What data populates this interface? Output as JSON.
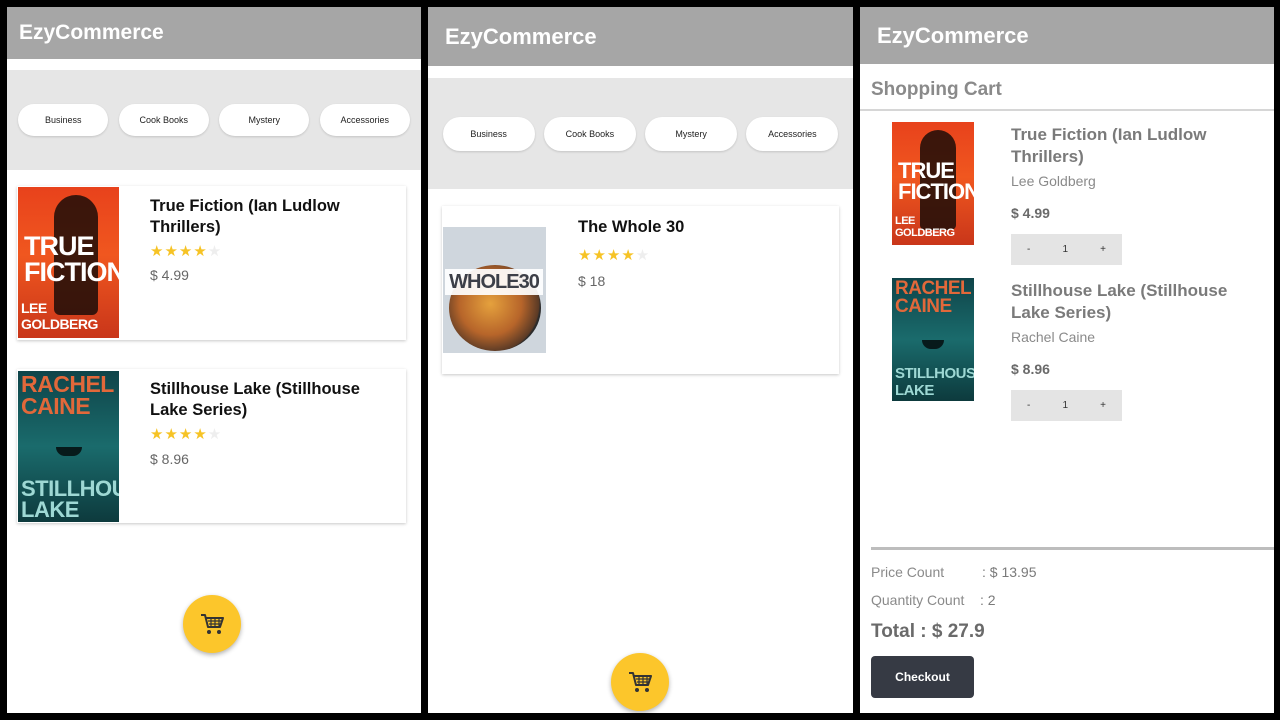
{
  "app": {
    "title": "EzyCommerce"
  },
  "categories": [
    "Business",
    "Cook Books",
    "Mystery",
    "Accessories"
  ],
  "colors": {
    "appbar": "#a6a6a6",
    "star": "#f6c325",
    "fab": "#fcc62b",
    "checkout_button": "#363a44"
  },
  "screen1": {
    "products": [
      {
        "title": "True Fiction (Ian Ludlow Thrillers)",
        "rating": 4,
        "max_rating": 5,
        "price": "$ 4.99",
        "cover_text": [
          "TRUE",
          "FICTION",
          "LEE GOLDBERG"
        ]
      },
      {
        "title": "Stillhouse Lake (Stillhouse Lake Series)",
        "rating": 4,
        "max_rating": 5,
        "price": "$ 8.96",
        "cover_text": [
          "RACHEL",
          "CAINE",
          "STILLHOUSE",
          "LAKE"
        ]
      }
    ],
    "fab_icon": "shopping-cart-icon"
  },
  "screen2": {
    "products": [
      {
        "title": "The Whole 30",
        "rating": 4,
        "max_rating": 5,
        "price": "$ 18",
        "cover_text": [
          "WHOLE30"
        ]
      }
    ],
    "fab_icon": "shopping-cart-icon"
  },
  "screen3": {
    "cart_title": "Shopping Cart",
    "items": [
      {
        "title": "True Fiction (Ian Ludlow Thrillers)",
        "author": "Lee Goldberg",
        "price": "$ 4.99",
        "quantity": "1",
        "decrement": "-",
        "increment": "+"
      },
      {
        "title": "Stillhouse Lake (Stillhouse Lake Series)",
        "author": "Rachel Caine",
        "price": "$ 8.96",
        "quantity": "1",
        "decrement": "-",
        "increment": "+"
      }
    ],
    "summary": {
      "price_label": "Price Count",
      "price_value": ": $ 13.95",
      "quantity_label": "Quantity Count",
      "quantity_value": ":  2",
      "total": "Total  : $ 27.9"
    },
    "checkout_label": "Checkout"
  }
}
